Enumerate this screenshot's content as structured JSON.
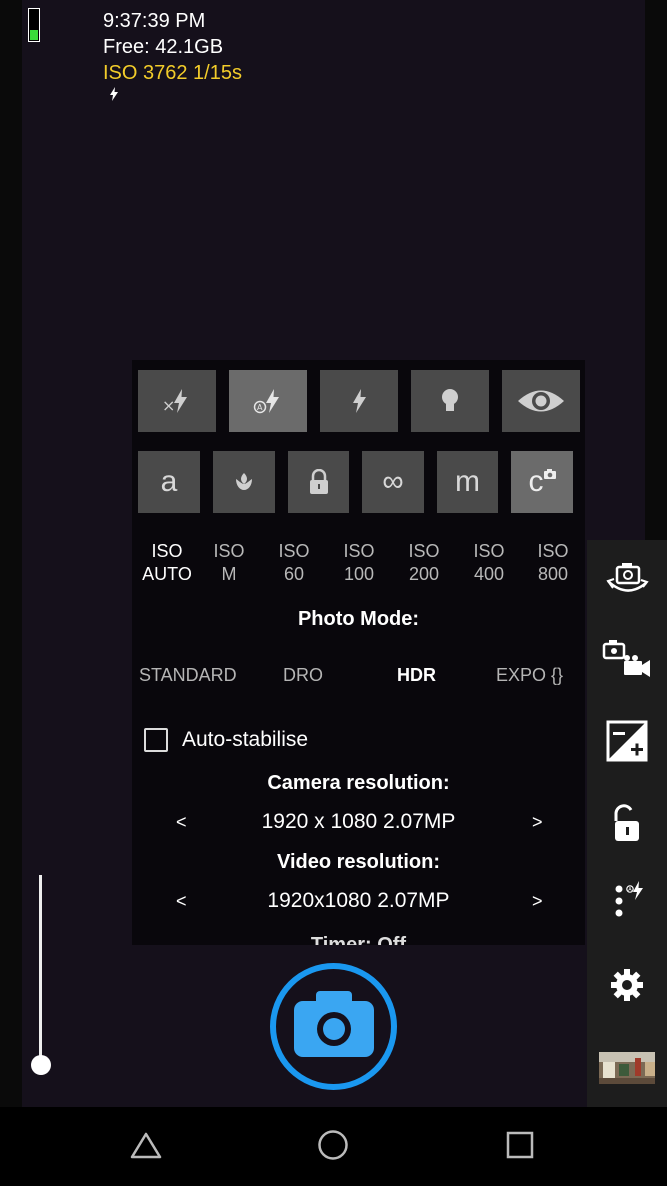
{
  "status": {
    "time": "9:37:39 PM",
    "free": "Free: 42.1GB",
    "iso_exposure": "ISO 3762  1/15s",
    "battery_level": 0.3
  },
  "flash_modes": [
    {
      "icon": "flash-off-icon",
      "selected": false
    },
    {
      "icon": "flash-auto-icon",
      "selected": true
    },
    {
      "icon": "flash-on-icon",
      "selected": false
    },
    {
      "icon": "torch-icon",
      "selected": false
    },
    {
      "icon": "red-eye-icon",
      "selected": false
    }
  ],
  "focus_modes": [
    {
      "icon": "focus-auto-icon",
      "label": "a",
      "selected": false
    },
    {
      "icon": "focus-macro-icon",
      "label": "",
      "selected": false
    },
    {
      "icon": "focus-locked-icon",
      "label": "",
      "selected": false
    },
    {
      "icon": "focus-infinity-icon",
      "label": "∞",
      "selected": false
    },
    {
      "icon": "focus-manual-icon",
      "label": "m",
      "selected": false
    },
    {
      "icon": "focus-continuous-icon",
      "label": "c",
      "selected": true
    }
  ],
  "iso": [
    {
      "top": "ISO",
      "bottom": "AUTO",
      "selected": true
    },
    {
      "top": "ISO",
      "bottom": "M",
      "selected": false
    },
    {
      "top": "ISO",
      "bottom": "60",
      "selected": false
    },
    {
      "top": "ISO",
      "bottom": "100",
      "selected": false
    },
    {
      "top": "ISO",
      "bottom": "200",
      "selected": false
    },
    {
      "top": "ISO",
      "bottom": "400",
      "selected": false
    },
    {
      "top": "ISO",
      "bottom": "800",
      "selected": false
    }
  ],
  "photo_mode": {
    "title": "Photo Mode:",
    "options": [
      "STANDARD",
      "DRO",
      "HDR",
      "EXPO {}"
    ],
    "selected": "HDR"
  },
  "auto_stabilise": {
    "label": "Auto-stabilise",
    "checked": false
  },
  "camera_resolution": {
    "title": "Camera resolution:",
    "value": "1920 x 1080 2.07MP",
    "prev": "<",
    "next": ">"
  },
  "video_resolution": {
    "title": "Video resolution:",
    "value": "1920x1080 2.07MP",
    "prev": "<",
    "next": ">"
  },
  "timer": {
    "label": "Timer: Off"
  },
  "zoom": {
    "level": 0
  },
  "toolbar": [
    "switch-camera-icon",
    "switch-video-icon",
    "exposure-icon",
    "exposure-lock-icon",
    "popup-menu-icon",
    "settings-icon",
    "gallery-thumbnail"
  ],
  "colors": {
    "accent": "#1a98f0",
    "iso_text": "#f2cc2a",
    "battery": "#3adb3a"
  }
}
